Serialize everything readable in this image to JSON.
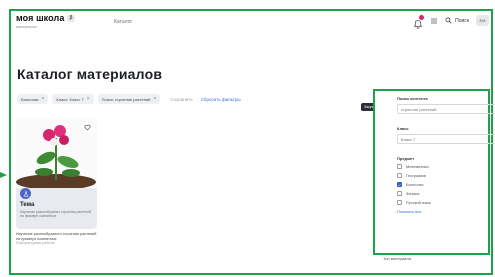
{
  "header": {
    "logo_title": "моя школа",
    "logo_badge": "β",
    "logo_subtitle": "материалы",
    "nav_link": "Каталог",
    "notifications_count": "9",
    "search_label": "Поиск",
    "avatar_initials": "ЕМ"
  },
  "page": {
    "title": "Каталог материалов"
  },
  "filters": {
    "chips": [
      "Биология",
      "Класс: Класс 7",
      "Поиск: строение растений"
    ],
    "label": "Сохранить",
    "reset_link": "Сбросить фильтры"
  },
  "card": {
    "title": "Тема",
    "description": "Изучение разнообразных строения растений на примере комнатных",
    "caption": "Изучение разнообразного строения растений на примере комнатных",
    "caption_meta": "Лабораторная работа"
  },
  "tooltip": {
    "text": "Закрыть"
  },
  "panel": {
    "search_label": "Поиск контента",
    "search_value": "строение растений",
    "class_label": "Класс",
    "class_value": "Класс 7",
    "subject_label": "Предмет",
    "subjects": [
      {
        "label": "Математика",
        "checked": false
      },
      {
        "label": "География",
        "checked": false
      },
      {
        "label": "Биология",
        "checked": true
      },
      {
        "label": "Физика",
        "checked": false
      },
      {
        "label": "Русский язык",
        "checked": false
      }
    ],
    "show_all": "Показать все"
  },
  "below_panel": {
    "label": "Тип материала",
    "value": "Урок"
  },
  "colors": {
    "accent": "#1aa34a",
    "primary": "#3b5fd0",
    "badge": "#e0245e"
  }
}
